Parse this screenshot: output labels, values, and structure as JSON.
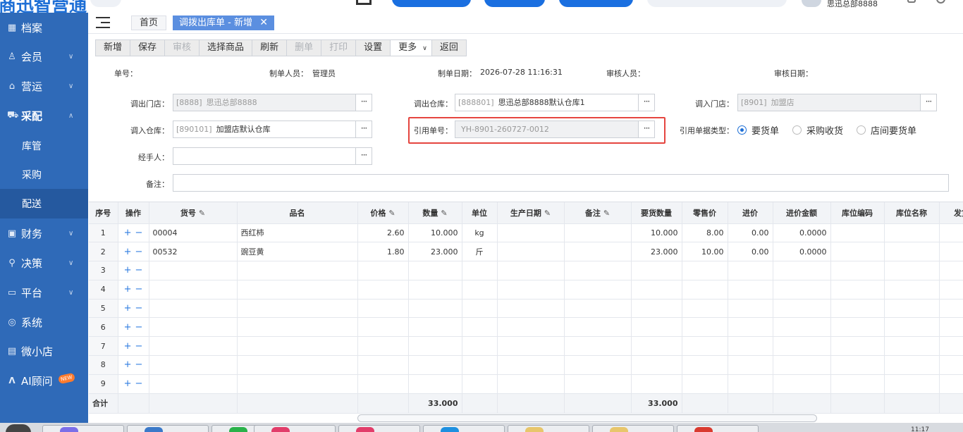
{
  "app": {
    "logo_text": "商迅智营通",
    "username": "思迅总部8888"
  },
  "sidebar": {
    "items": [
      {
        "label": "档案",
        "icon": "grid-icon",
        "expandable": false
      },
      {
        "label": "会员",
        "icon": "user-icon",
        "expandable": true
      },
      {
        "label": "营运",
        "icon": "store-icon",
        "expandable": true
      },
      {
        "label": "采配",
        "icon": "delivery-icon",
        "expandable": true,
        "expanded": true
      },
      {
        "label": "财务",
        "icon": "wallet-icon",
        "expandable": true
      },
      {
        "label": "决策",
        "icon": "chart-icon",
        "expandable": true
      },
      {
        "label": "平台",
        "icon": "monitor-icon",
        "expandable": true
      },
      {
        "label": "系统",
        "icon": "settings-icon",
        "expandable": false
      },
      {
        "label": "微小店",
        "icon": "shop-icon",
        "expandable": false
      },
      {
        "label": "AI顾问",
        "icon": "ai-icon",
        "expandable": false,
        "badge": "NEW"
      }
    ],
    "subitems": [
      {
        "label": "库管",
        "active": false
      },
      {
        "label": "采购",
        "active": false
      },
      {
        "label": "配送",
        "active": true
      }
    ]
  },
  "tabs": {
    "home": "首页",
    "active": "调拨出库单 - 新增"
  },
  "toolbar": {
    "buttons": [
      {
        "label": "新增",
        "disabled": false
      },
      {
        "label": "保存",
        "disabled": false
      },
      {
        "label": "审核",
        "disabled": true
      },
      {
        "label": "选择商品",
        "disabled": false
      },
      {
        "label": "刷新",
        "disabled": false
      },
      {
        "label": "删单",
        "disabled": true
      },
      {
        "label": "打印",
        "disabled": true
      },
      {
        "label": "设置",
        "disabled": false
      },
      {
        "label": "更多",
        "disabled": false,
        "dropdown": true
      },
      {
        "label": "返回",
        "disabled": false
      }
    ]
  },
  "info": {
    "order_no_label": "单号：",
    "creator_label": "制单人员：",
    "creator": "管理员",
    "date_label": "制单日期：",
    "date": "2026-07-28 11:16:31",
    "reviewer_label": "审核人员：",
    "review_date_label": "审核日期："
  },
  "form": {
    "out_store_label": "调出门店：",
    "out_store_code": "[8888]",
    "out_store_name": "思迅总部8888",
    "out_wh_label": "调出仓库：",
    "out_wh_code": "[888801]",
    "out_wh_name": "思迅总部8888默认仓库1",
    "in_store_label": "调入门店：",
    "in_store_code": "[8901]",
    "in_store_name": "加盟店",
    "in_wh_label": "调入仓库：",
    "in_wh_code": "[890101]",
    "in_wh_name": "加盟店默认仓库",
    "ref_label": "引用单号：",
    "ref_value": "YH-8901-260727-0012",
    "ref_type_label": "引用单据类型：",
    "ref_types": [
      {
        "label": "要货单",
        "selected": true
      },
      {
        "label": "采购收货",
        "selected": false
      },
      {
        "label": "店间要货单",
        "selected": false
      }
    ],
    "handler_label": "经手人：",
    "handler_value": "",
    "note_label": "备注：",
    "note_value": "",
    "dots": "···"
  },
  "grid": {
    "columns": [
      "序号",
      "操作",
      "货号",
      "品名",
      "价格",
      "数量",
      "单位",
      "生产日期",
      "备注",
      "要货数量",
      "零售价",
      "进价",
      "进价金额",
      "库位编码",
      "库位名称",
      "发货"
    ],
    "editable_columns": [
      "货号",
      "价格",
      "数量",
      "生产日期",
      "备注"
    ],
    "ops": {
      "plus": "+",
      "minus": "−"
    },
    "rows": [
      {
        "seq": "1",
        "code": "00004",
        "name": "西红柿",
        "price": "2.60",
        "qty": "10.000",
        "unit": "kg",
        "date": "",
        "note": "",
        "req_qty": "10.000",
        "retail": "8.00",
        "cost": "0.00",
        "cost_amt": "0.0000",
        "loc_code": "",
        "loc_name": "",
        "ship": ""
      },
      {
        "seq": "2",
        "code": "00532",
        "name": "豌豆黄",
        "price": "1.80",
        "qty": "23.000",
        "unit": "斤",
        "date": "",
        "note": "",
        "req_qty": "23.000",
        "retail": "10.00",
        "cost": "0.00",
        "cost_amt": "0.0000",
        "loc_code": "",
        "loc_name": "",
        "ship": ""
      },
      {
        "seq": "3"
      },
      {
        "seq": "4"
      },
      {
        "seq": "5"
      },
      {
        "seq": "6"
      },
      {
        "seq": "7"
      },
      {
        "seq": "8"
      },
      {
        "seq": "9"
      }
    ],
    "total": {
      "label": "合计",
      "qty": "33.000",
      "req_qty": "33.000"
    }
  },
  "taskbar": {
    "clock": "11:17"
  },
  "colors": {
    "sidebar": "#2f6ab8",
    "sidebar_active": "#25599f",
    "accent": "#1e6fd6",
    "tab_active": "#5b8fe0",
    "highlight_border": "#e5453f"
  }
}
